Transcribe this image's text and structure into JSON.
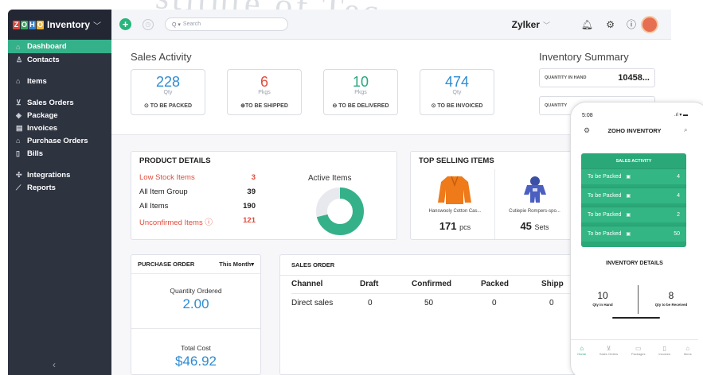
{
  "brand": {
    "name": "Inventory",
    "logo_letters": [
      "Z",
      "O",
      "H",
      "O"
    ]
  },
  "sidebar": {
    "items": [
      {
        "label": "Dashboard",
        "icon": "home-icon"
      },
      {
        "label": "Contacts",
        "icon": "user-icon"
      },
      {
        "label": "Items",
        "icon": "tag-icon"
      },
      {
        "label": "Sales Orders",
        "icon": "cart-icon"
      },
      {
        "label": "Package",
        "icon": "package-icon"
      },
      {
        "label": "Invoices",
        "icon": "invoice-icon"
      },
      {
        "label": "Purchase Orders",
        "icon": "bag-icon"
      },
      {
        "label": "Bills",
        "icon": "bill-icon"
      },
      {
        "label": "Integrations",
        "icon": "puzzle-icon"
      },
      {
        "label": "Reports",
        "icon": "chart-icon"
      }
    ],
    "collapse": "‹"
  },
  "topbar": {
    "search_placeholder": "Search",
    "org": "Zylker"
  },
  "sales_activity": {
    "title": "Sales Activity",
    "cards": [
      {
        "value": "228",
        "unit": "Qty",
        "label": "TO BE PACKED",
        "color": "#2d8bd2"
      },
      {
        "value": "6",
        "unit": "Pkgs",
        "label": "TO BE SHIPPED",
        "color": "#e14b3b"
      },
      {
        "value": "10",
        "unit": "Pkgs",
        "label": "TO BE DELIVERED",
        "color": "#28a87c"
      },
      {
        "value": "474",
        "unit": "Qty",
        "label": "TO BE INVOICED",
        "color": "#2d8bd2"
      }
    ]
  },
  "inventory_summary": {
    "title": "Inventory Summary",
    "rows": [
      {
        "label": "QUANTITY IN HAND",
        "value": "10458..."
      },
      {
        "label": "QUANTITY",
        "value": ""
      }
    ]
  },
  "product_details": {
    "title": "PRODUCT DETAILS",
    "rows": [
      {
        "label": "Low Stock Items",
        "value": "3"
      },
      {
        "label": "All Item Group",
        "value": "39"
      },
      {
        "label": "All Items",
        "value": "190"
      },
      {
        "label": "Unconfirmed Items ⓘ",
        "value": "121"
      }
    ],
    "active_items_title": "Active Items",
    "active_items_percent": "71%",
    "active_items_fraction": 0.71
  },
  "top_selling": {
    "title": "TOP SELLING ITEMS",
    "items": [
      {
        "name": "Hanswooly Cotton Cas...",
        "qty": "171",
        "unit": "pcs"
      },
      {
        "name": "Cutiepie Rompers-spo...",
        "qty": "45",
        "unit": "Sets"
      }
    ]
  },
  "purchase_order": {
    "title": "PURCHASE ORDER",
    "period": "This Month",
    "quantity_label": "Quantity Ordered",
    "quantity_value": "2.00",
    "cost_label": "Total Cost",
    "cost_value": "$46.92"
  },
  "sales_order": {
    "title": "SALES ORDER",
    "columns": [
      "Channel",
      "Draft",
      "Confirmed",
      "Packed",
      "Shipp"
    ],
    "rows": [
      [
        "Direct sales",
        "0",
        "50",
        "0",
        "0"
      ]
    ]
  },
  "phone": {
    "time": "5:08",
    "title": "ZOHO INVENTORY",
    "sa_title": "SALES ACTIVITY",
    "rows": [
      {
        "label": "To be Packed",
        "value": "4"
      },
      {
        "label": "To be Packed",
        "value": "4"
      },
      {
        "label": "To be Packed",
        "value": "2"
      },
      {
        "label": "To be Packed",
        "value": "50"
      }
    ],
    "inv_title": "INVENTORY DETAILS",
    "qty_in_hand": "10",
    "qty_in_hand_label": "Qty in Hand",
    "qty_to_receive": "8",
    "qty_to_receive_label": "Qty to be Received",
    "tabs": [
      "Home",
      "Sales Orders",
      "Packages",
      "Invoices",
      "Items"
    ]
  },
  "watermark": "stitute of Tec"
}
